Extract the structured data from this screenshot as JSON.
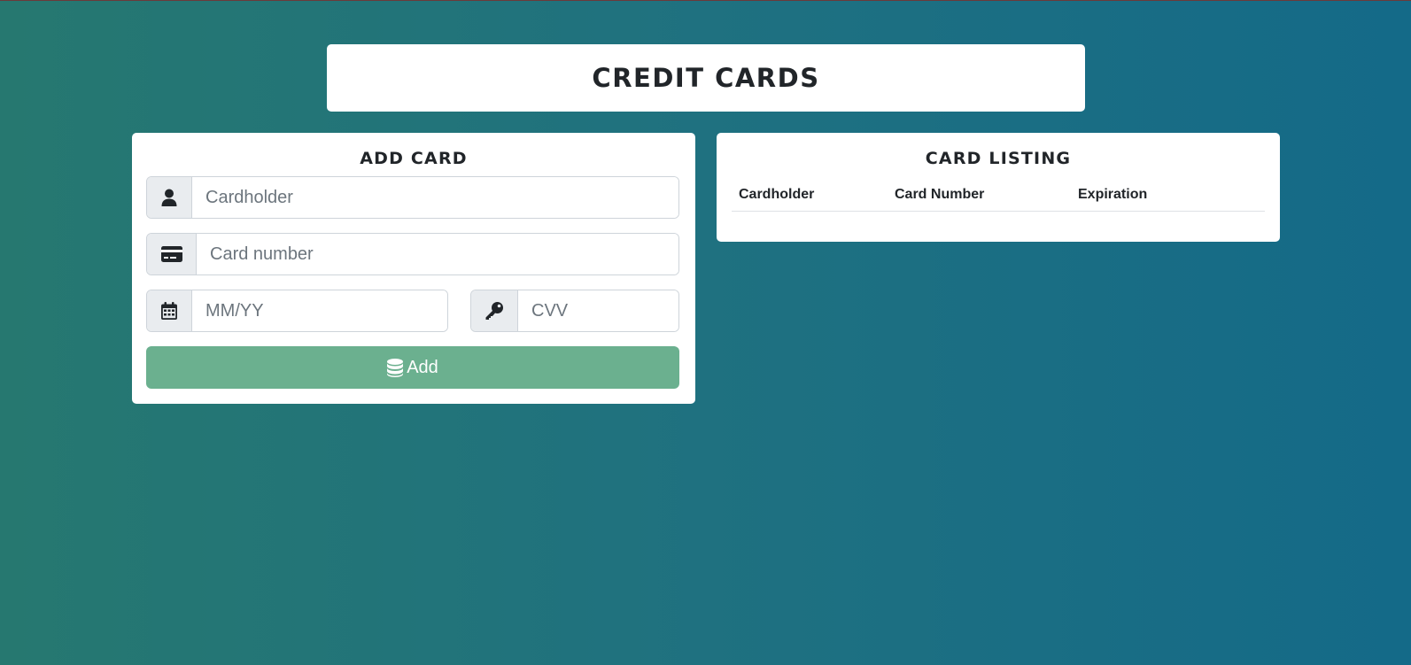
{
  "page": {
    "title": "Credit Cards"
  },
  "add_card": {
    "title": "Add Card",
    "cardholder": {
      "placeholder": "Cardholder",
      "icon": "user-icon"
    },
    "card_number": {
      "placeholder": "Card number",
      "icon": "credit-card-icon"
    },
    "expiry": {
      "placeholder": "MM/YY",
      "icon": "calendar-icon"
    },
    "cvv": {
      "placeholder": "CVV",
      "icon": "key-icon"
    },
    "add_button": {
      "label": "Add",
      "icon": "database-icon"
    }
  },
  "card_listing": {
    "title": "Card Listing",
    "columns": [
      "Cardholder",
      "Card Number",
      "Expiration"
    ],
    "rows": []
  },
  "colors": {
    "background_start": "#267870",
    "background_end": "#146a88",
    "add_button": "#6bb08f",
    "panel": "#ffffff"
  }
}
